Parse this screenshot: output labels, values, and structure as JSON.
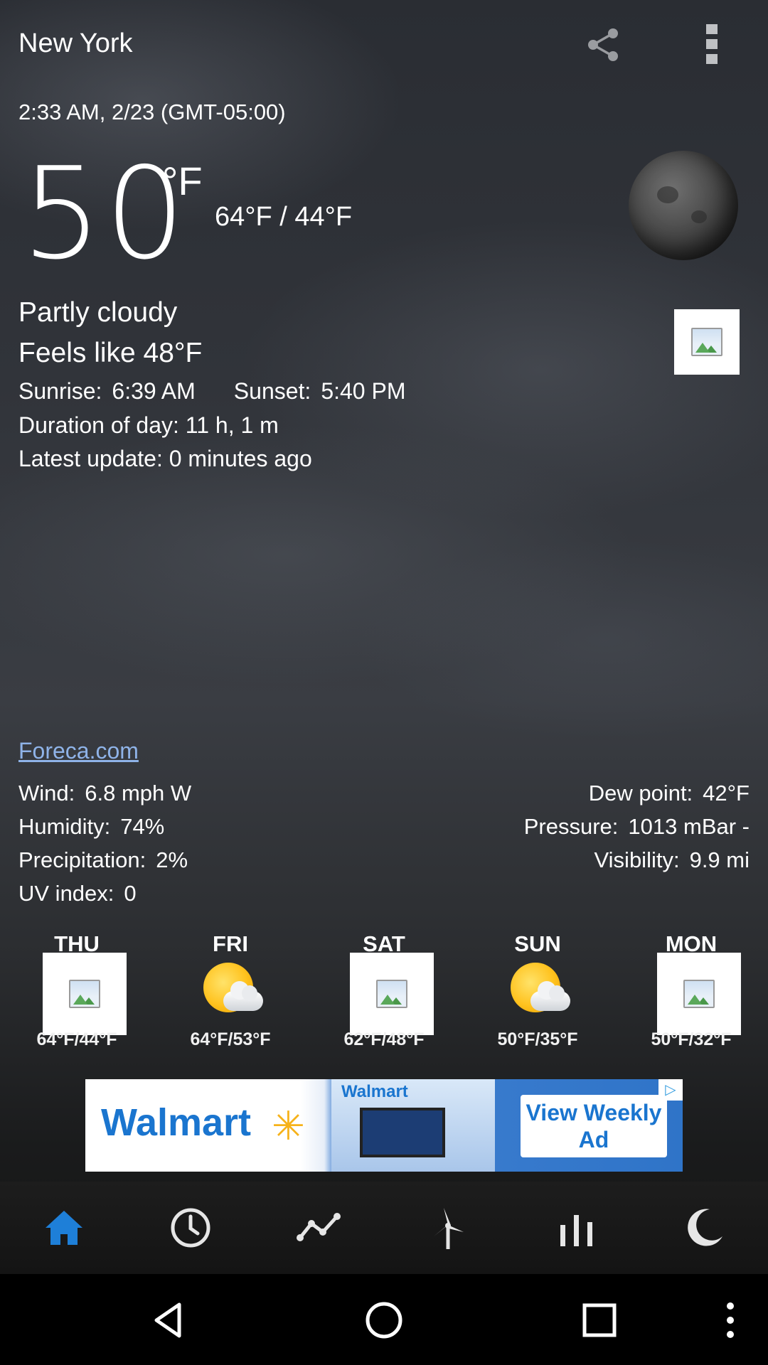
{
  "header": {
    "city": "New York",
    "share_icon": "share-icon",
    "more_icon": "more-vert-icon"
  },
  "current": {
    "datetime": "2:33 AM, 2/23 (GMT-05:00)",
    "temperature": "50",
    "unit": "°F",
    "hi_lo": "64°F / 44°F",
    "condition": "Partly cloudy",
    "feels_like": "Feels like 48°F",
    "sunrise_label": "Sunrise:",
    "sunrise_value": "6:39 AM",
    "sunset_label": "Sunset:",
    "sunset_value": "5:40 PM",
    "duration": "Duration of day: 11 h, 1 m",
    "latest_update": "Latest update: 0 minutes ago",
    "moon_icon": "moon-icon"
  },
  "source_link": "Foreca.com",
  "details": {
    "wind_label": "Wind:",
    "wind_value": "6.8 mph W",
    "humidity_label": "Humidity:",
    "humidity_value": "74%",
    "precip_label": "Precipitation:",
    "precip_value": "2%",
    "uv_label": "UV index:",
    "uv_value": "0",
    "dew_label": "Dew point:",
    "dew_value": "42°F",
    "pressure_label": "Pressure:",
    "pressure_value": "1013 mBar -",
    "visibility_label": "Visibility:",
    "visibility_value": "9.9 mi"
  },
  "forecast": [
    {
      "day": "THU",
      "range": "64°F/44°F",
      "icon": "broken-image-icon"
    },
    {
      "day": "FRI",
      "range": "64°F/53°F",
      "icon": "partly-sunny-icon"
    },
    {
      "day": "SAT",
      "range": "62°F/48°F",
      "icon": "broken-image-icon"
    },
    {
      "day": "SUN",
      "range": "50°F/35°F",
      "icon": "partly-sunny-icon"
    },
    {
      "day": "MON",
      "range": "50°F/32°F",
      "icon": "broken-image-icon"
    }
  ],
  "ad": {
    "brand": "Walmart",
    "mock_brand": "Walmart",
    "cta": "View Weekly Ad"
  },
  "bottom_nav": [
    {
      "name": "home",
      "icon": "home-icon",
      "active": true
    },
    {
      "name": "hourly",
      "icon": "clock-icon",
      "active": false
    },
    {
      "name": "graph",
      "icon": "line-chart-icon",
      "active": false
    },
    {
      "name": "wind",
      "icon": "wind-turbine-icon",
      "active": false
    },
    {
      "name": "bars",
      "icon": "bar-chart-icon",
      "active": false
    },
    {
      "name": "night",
      "icon": "moon-icon",
      "active": false
    }
  ],
  "colors": {
    "accent": "#1e7fd8",
    "link": "#8fb3e8",
    "walmart_blue": "#1a75cf",
    "walmart_yellow": "#f6b21a"
  }
}
